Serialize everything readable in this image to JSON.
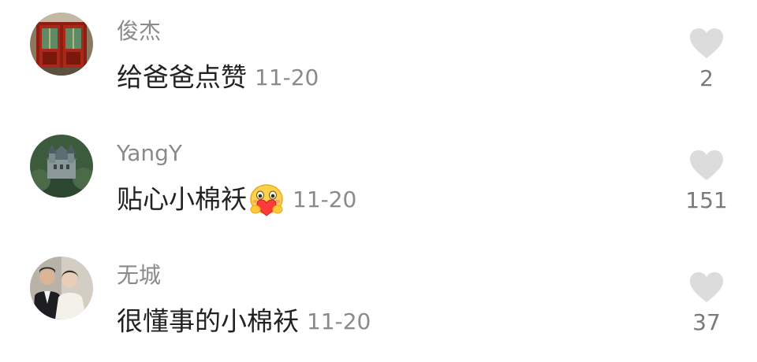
{
  "comments": [
    {
      "avatar_icon": "door-avatar",
      "username": "俊杰",
      "text": "给爸爸点赞",
      "emoji": "",
      "date": "11-20",
      "likes": "2"
    },
    {
      "avatar_icon": "castle-avatar",
      "username": "YangY",
      "text": "贴心小棉袄",
      "emoji": "hugging-heart-emoji",
      "date": "11-20",
      "likes": "151"
    },
    {
      "avatar_icon": "couple-photo-avatar",
      "username": "无城",
      "text": "很懂事的小棉袄",
      "emoji": "",
      "date": "11-20",
      "likes": "37"
    }
  ],
  "icons": {
    "like": "heart-icon"
  },
  "colors": {
    "background": "#ffffff",
    "username": "#8a8a8a",
    "comment_text": "#222222",
    "date": "#8a8a8a",
    "like_icon": "#dcdcdc",
    "like_count": "#7a7a7a"
  }
}
